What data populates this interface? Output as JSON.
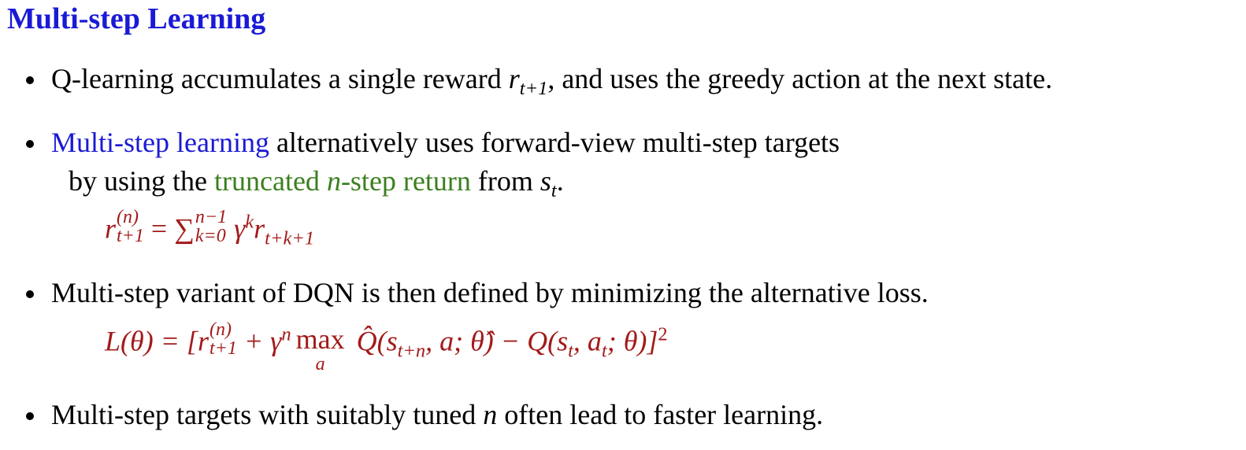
{
  "title": "Multi-step Learning",
  "bullets": {
    "b1": {
      "text_before": "Q-learning accumulates a single reward ",
      "sym": "r",
      "sub": "t+1",
      "text_after": ", and uses the greedy action at the next state."
    },
    "b2": {
      "highlight": "Multi-step learning",
      "text1": " alternatively uses forward-view multi-step targets",
      "line2_a": "by using the ",
      "green_a": "truncated ",
      "green_n": "n",
      "green_b": "-step return",
      "line2_b": " from ",
      "s": "s",
      "s_sub": "t",
      "period": "."
    },
    "b3": {
      "text": "Multi-step variant of DQN is then defined by minimizing the alternative loss."
    },
    "b4": {
      "text_before": "Multi-step targets with suitably tuned ",
      "n": "n",
      "text_after": " often lead to faster learning."
    }
  },
  "equations": {
    "eq1": {
      "r": "r",
      "sup": "(n)",
      "sub": "t+1",
      "eq": " = ",
      "sum": "∑",
      "sum_sup": "n−1",
      "sum_sub": "k=0",
      "gamma": " γ",
      "gamma_sup": "k",
      "r2": "r",
      "r2_sub": "t+k+1"
    },
    "eq2": {
      "lhs": "L(θ) = [",
      "r": "r",
      "sup": "(n)",
      "sub": "t+1",
      "plus": " + γ",
      "gamma_sup": "n",
      "max": "max",
      "max_under": "a",
      "qhat": " Q̂(s",
      "qhat_sub": "t+n",
      "qhat_rest": ", a; θ̂) − Q(s",
      "q_sub1": "t",
      "q_mid": ", a",
      "q_sub2": "t",
      "q_end": "; θ)]",
      "power": "2"
    }
  },
  "colors": {
    "title": "#1a1ad6",
    "highlight_blue": "#1a1ad6",
    "green": "#3b7f1e",
    "equation_red": "#a31a1a"
  }
}
